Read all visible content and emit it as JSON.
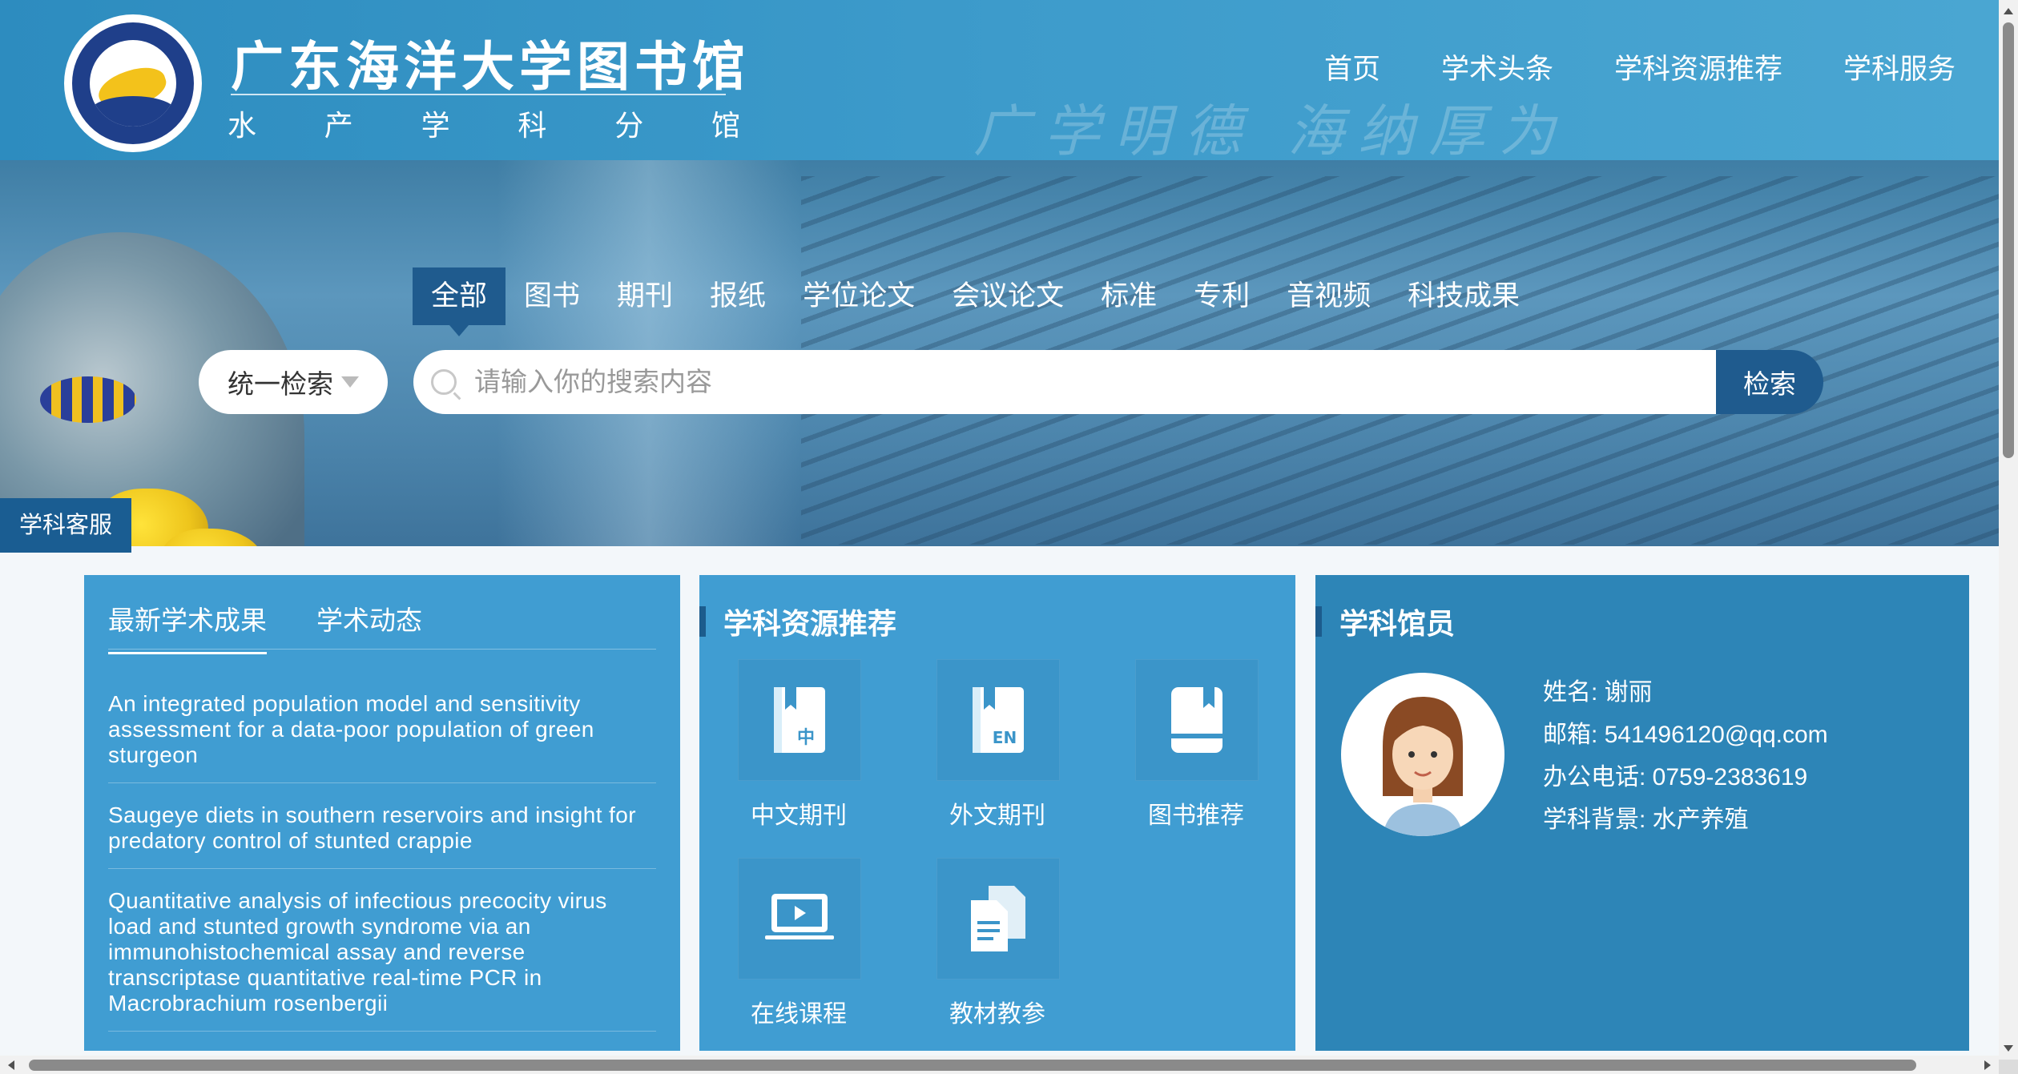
{
  "header": {
    "title": "广东海洋大学图书馆",
    "subtitle_chars": [
      "水",
      "产",
      "学",
      "科",
      "分",
      "馆"
    ],
    "motto": "广学明德 海纳厚为",
    "logo_icon": "university-seal-icon"
  },
  "nav": [
    "首页",
    "学术头条",
    "学科资源推荐",
    "学科服务"
  ],
  "search": {
    "tabs": [
      "全部",
      "图书",
      "期刊",
      "报纸",
      "学位论文",
      "会议论文",
      "标准",
      "专利",
      "音视频",
      "科技成果"
    ],
    "active_tab": "全部",
    "scope": "统一检索",
    "placeholder": "请输入你的搜索内容",
    "button": "检索"
  },
  "float_service": "学科客服",
  "academic": {
    "tabs": [
      "最新学术成果",
      "学术动态"
    ],
    "active_tab": "最新学术成果",
    "items": [
      "An integrated population model and sensitivity assessment for a data-poor population of green sturgeon",
      "Saugeye diets in southern reservoirs and insight for predatory control of stunted crappie",
      "Quantitative analysis of infectious precocity virus load and stunted growth syndrome via an immunohistochemical assay and reverse transcriptase quantitative real-time PCR in Macrobrachium rosenbergii"
    ]
  },
  "resources": {
    "title": "学科资源推荐",
    "items": [
      {
        "label": "中文期刊",
        "icon": "chinese-journal-icon",
        "badge": "中"
      },
      {
        "label": "外文期刊",
        "icon": "foreign-journal-icon",
        "badge": "EN"
      },
      {
        "label": "图书推荐",
        "icon": "book-icon"
      },
      {
        "label": "在线课程",
        "icon": "online-course-icon"
      },
      {
        "label": "教材教参",
        "icon": "documents-icon"
      }
    ]
  },
  "librarian": {
    "title": "学科馆员",
    "name": "姓名: 谢丽",
    "email": "邮箱: 541496120@qq.com",
    "phone": "办公电话: 0759-2383619",
    "background": "学科背景: 水产养殖"
  },
  "colors": {
    "header": "#3d9bcb",
    "accent_dark": "#1f5b8e",
    "panel": "#409dd2",
    "panel_dark": "#2d85b7"
  }
}
